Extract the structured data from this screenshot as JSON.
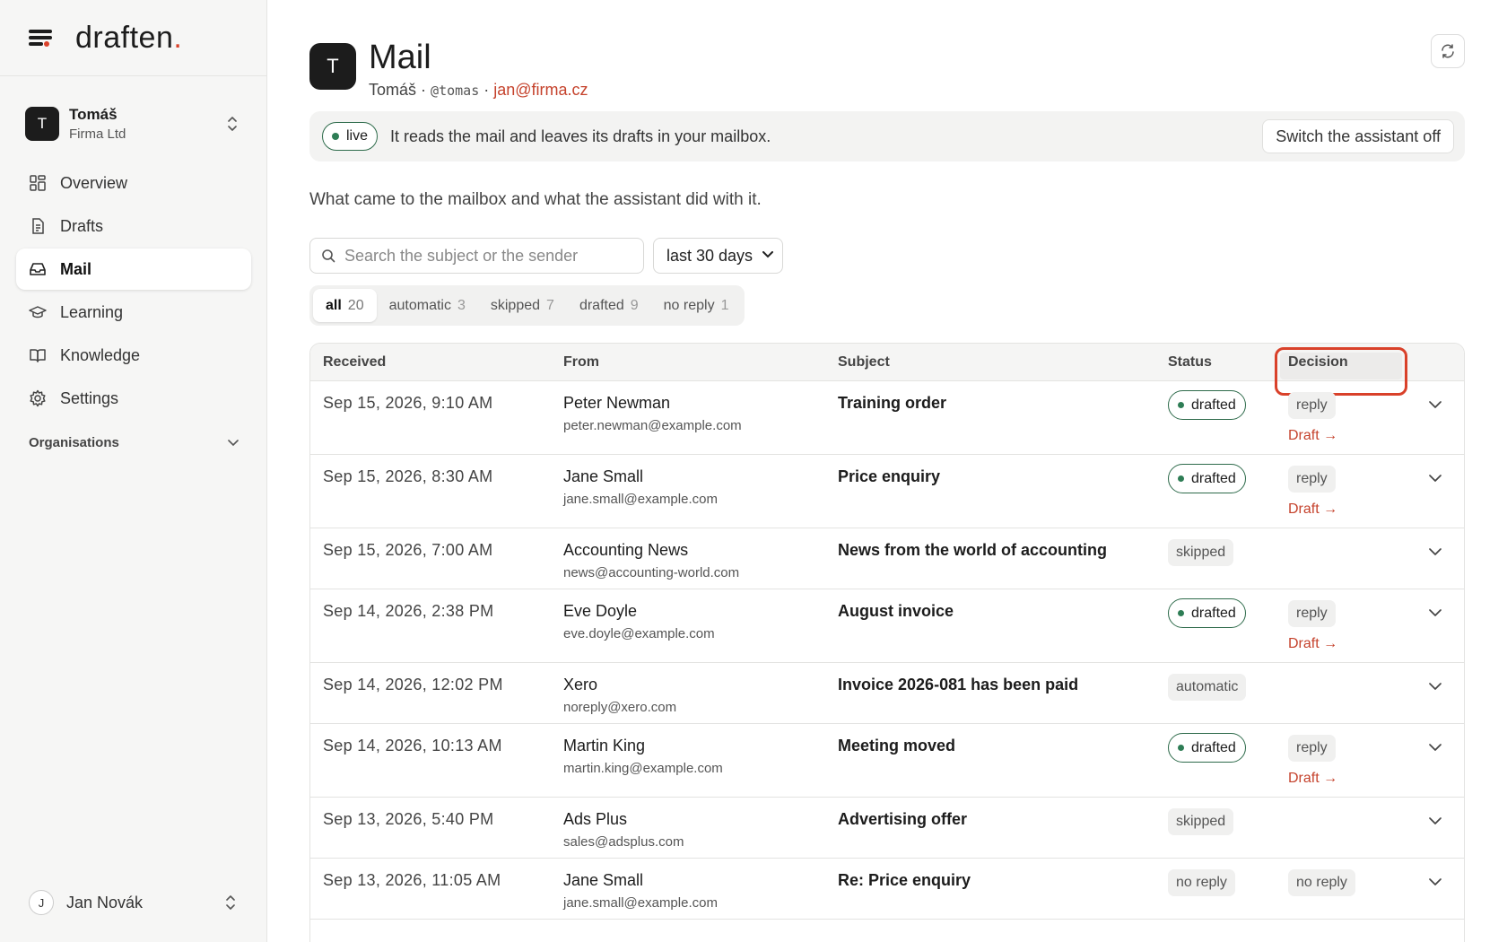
{
  "brand": {
    "name": "draften",
    "dot": "."
  },
  "account": {
    "initial": "T",
    "name": "Tomáš",
    "org": "Firma Ltd"
  },
  "nav": [
    {
      "label": "Overview",
      "icon": "grid-icon",
      "active": false
    },
    {
      "label": "Drafts",
      "icon": "document-icon",
      "active": false
    },
    {
      "label": "Mail",
      "icon": "inbox-icon",
      "active": true
    },
    {
      "label": "Learning",
      "icon": "graduation-cap-icon",
      "active": false
    },
    {
      "label": "Knowledge",
      "icon": "book-icon",
      "active": false
    },
    {
      "label": "Settings",
      "icon": "gear-icon",
      "active": false
    }
  ],
  "organisations_label": "Organisations",
  "user": {
    "initial": "J",
    "name": "Jan Novák"
  },
  "header": {
    "initial": "T",
    "title": "Mail",
    "name": "Tomáš",
    "sep": "·",
    "handle": "@tomas",
    "email": "jan@firma.cz"
  },
  "banner": {
    "status": "live",
    "text": "It reads the mail and leaves its drafts in your mailbox.",
    "button": "Switch the assistant off"
  },
  "intro": "What came to the mailbox and what the assistant did with it.",
  "search": {
    "placeholder": "Search the subject or the sender",
    "value": ""
  },
  "range": {
    "selected": "last 30 days"
  },
  "tabs": [
    {
      "label": "all",
      "count": "20",
      "active": true
    },
    {
      "label": "automatic",
      "count": "3",
      "active": false
    },
    {
      "label": "skipped",
      "count": "7",
      "active": false
    },
    {
      "label": "drafted",
      "count": "9",
      "active": false
    },
    {
      "label": "no reply",
      "count": "1",
      "active": false
    }
  ],
  "columns": {
    "received": "Received",
    "from": "From",
    "subject": "Subject",
    "status": "Status",
    "decision": "Decision"
  },
  "draft_link": "Draft →",
  "rows": [
    {
      "received": "Sep 15, 2026, 9:10 AM",
      "name": "Peter Newman",
      "email": "peter.newman@example.com",
      "subject": "Training order",
      "status": "drafted",
      "decision": "reply",
      "draft": true
    },
    {
      "received": "Sep 15, 2026, 8:30 AM",
      "name": "Jane Small",
      "email": "jane.small@example.com",
      "subject": "Price enquiry",
      "status": "drafted",
      "decision": "reply",
      "draft": true
    },
    {
      "received": "Sep 15, 2026, 7:00 AM",
      "name": "Accounting News",
      "email": "news@accounting-world.com",
      "subject": "News from the world of accounting",
      "status": "skipped",
      "decision": "",
      "draft": false
    },
    {
      "received": "Sep 14, 2026, 2:38 PM",
      "name": "Eve Doyle",
      "email": "eve.doyle@example.com",
      "subject": "August invoice",
      "status": "drafted",
      "decision": "reply",
      "draft": true
    },
    {
      "received": "Sep 14, 2026, 12:02 PM",
      "name": "Xero",
      "email": "noreply@xero.com",
      "subject": "Invoice 2026-081 has been paid",
      "status": "automatic",
      "decision": "",
      "draft": false
    },
    {
      "received": "Sep 14, 2026, 10:13 AM",
      "name": "Martin King",
      "email": "martin.king@example.com",
      "subject": "Meeting moved",
      "status": "drafted",
      "decision": "reply",
      "draft": true
    },
    {
      "received": "Sep 13, 2026, 5:40 PM",
      "name": "Ads Plus",
      "email": "sales@adsplus.com",
      "subject": "Advertising offer",
      "status": "skipped",
      "decision": "",
      "draft": false
    },
    {
      "received": "Sep 13, 2026, 11:05 AM",
      "name": "Jane Small",
      "email": "jane.small@example.com",
      "subject": "Re: Price enquiry",
      "status": "no reply",
      "decision": "no reply",
      "draft": false
    }
  ],
  "colors": {
    "accent": "#d9412a",
    "link": "#c5422c",
    "live_green": "#2e7d55"
  }
}
